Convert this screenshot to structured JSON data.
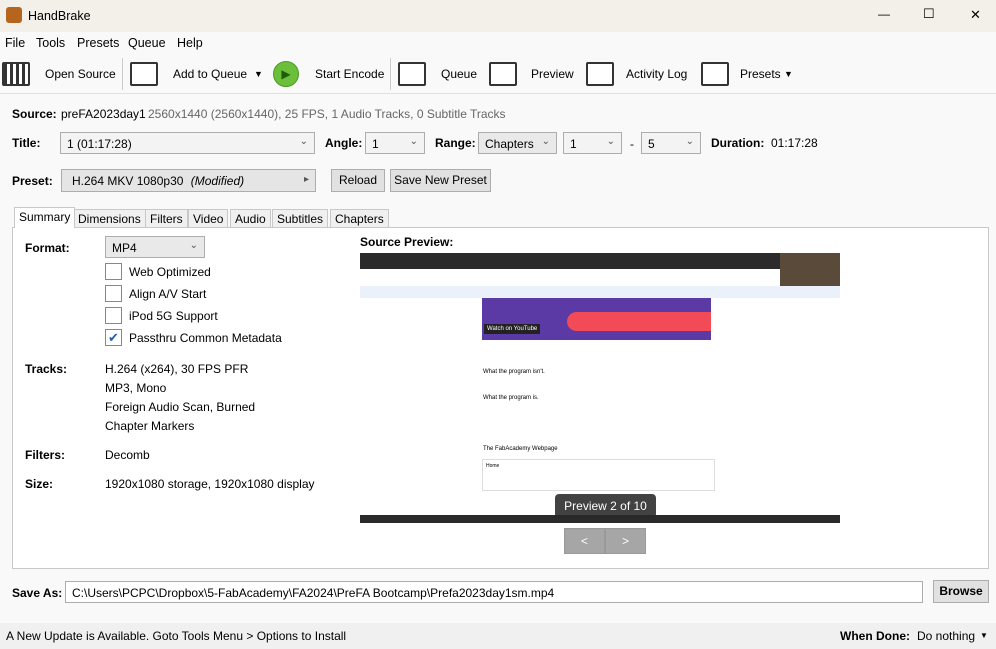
{
  "window": {
    "title": "HandBrake",
    "minimize": "—",
    "maximize": "☐",
    "close": "✕"
  },
  "menu": [
    "File",
    "Tools",
    "Presets",
    "Queue",
    "Help"
  ],
  "toolbar": {
    "open_source": "Open Source",
    "add_to_queue": "Add to Queue",
    "start_encode": "Start Encode",
    "queue": "Queue",
    "preview": "Preview",
    "activity_log": "Activity Log",
    "presets": "Presets"
  },
  "source": {
    "label": "Source:",
    "name": "preFA2023day1",
    "info": "2560x1440 (2560x1440), 25 FPS, 1 Audio Tracks, 0 Subtitle Tracks"
  },
  "title_row": {
    "title_label": "Title:",
    "title_value": "1  (01:17:28)",
    "angle_label": "Angle:",
    "angle_value": "1",
    "range_label": "Range:",
    "range_mode": "Chapters",
    "range_start": "1",
    "range_dash": "-",
    "range_end": "5",
    "duration_label": "Duration:",
    "duration_value": "01:17:28"
  },
  "preset": {
    "label": "Preset:",
    "value": "H.264 MKV 1080p30",
    "modified": "(Modified)",
    "reload": "Reload",
    "save_new": "Save New Preset"
  },
  "tabs": [
    "Summary",
    "Dimensions",
    "Filters",
    "Video",
    "Audio",
    "Subtitles",
    "Chapters"
  ],
  "summary": {
    "format_label": "Format:",
    "format_value": "MP4",
    "options": [
      {
        "label": "Web Optimized",
        "checked": false
      },
      {
        "label": "Align A/V Start",
        "checked": false
      },
      {
        "label": "iPod 5G Support",
        "checked": false
      },
      {
        "label": "Passthru Common Metadata",
        "checked": true
      }
    ],
    "tracks_label": "Tracks:",
    "tracks": [
      "H.264 (x264), 30 FPS PFR",
      "MP3, Mono",
      "Foreign Audio Scan, Burned",
      "Chapter Markers"
    ],
    "filters_label": "Filters:",
    "filters_value": "Decomb",
    "size_label": "Size:",
    "size_value": "1920x1080 storage, 1920x1080 display"
  },
  "preview": {
    "label": "Source Preview:",
    "overlay": "Preview 2 of 10",
    "prev": "<",
    "next": ">",
    "content": {
      "watch": "Watch on YouTube",
      "h1": "What the program isn't.",
      "h2": "What the program is.",
      "h3": "The FabAcademy Webpage",
      "home": "Home"
    }
  },
  "save_as": {
    "label": "Save As:",
    "path": "C:\\Users\\PCPC\\Dropbox\\5-FabAcademy\\FA2024\\PreFA Bootcamp\\Prefa2023day1sm.mp4",
    "browse": "Browse"
  },
  "status": {
    "message": "A New Update is Available. Goto Tools Menu > Options to Install",
    "when_done_label": "When Done:",
    "when_done_value": "Do nothing"
  }
}
